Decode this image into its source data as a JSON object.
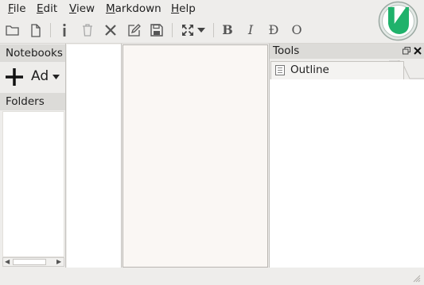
{
  "menu": {
    "file": {
      "acc": "F",
      "rest": "ile"
    },
    "edit": {
      "acc": "E",
      "rest": "dit"
    },
    "view": {
      "acc": "V",
      "rest": "iew"
    },
    "markdown": {
      "acc": "M",
      "rest": "arkdown"
    },
    "help": {
      "acc": "H",
      "rest": "elp"
    }
  },
  "toolbar": {
    "bold": "B",
    "italic": "I",
    "strike": "Đ",
    "code": "O"
  },
  "left_panel": {
    "notebooks_title": "Notebooks",
    "add_notebook_label": "Ad",
    "folders_title": "Folders"
  },
  "tools": {
    "title": "Tools",
    "tab_outline": "Outline"
  },
  "colors": {
    "logo_green": "#1fb26b",
    "editor_bg": "#faf7f4"
  }
}
